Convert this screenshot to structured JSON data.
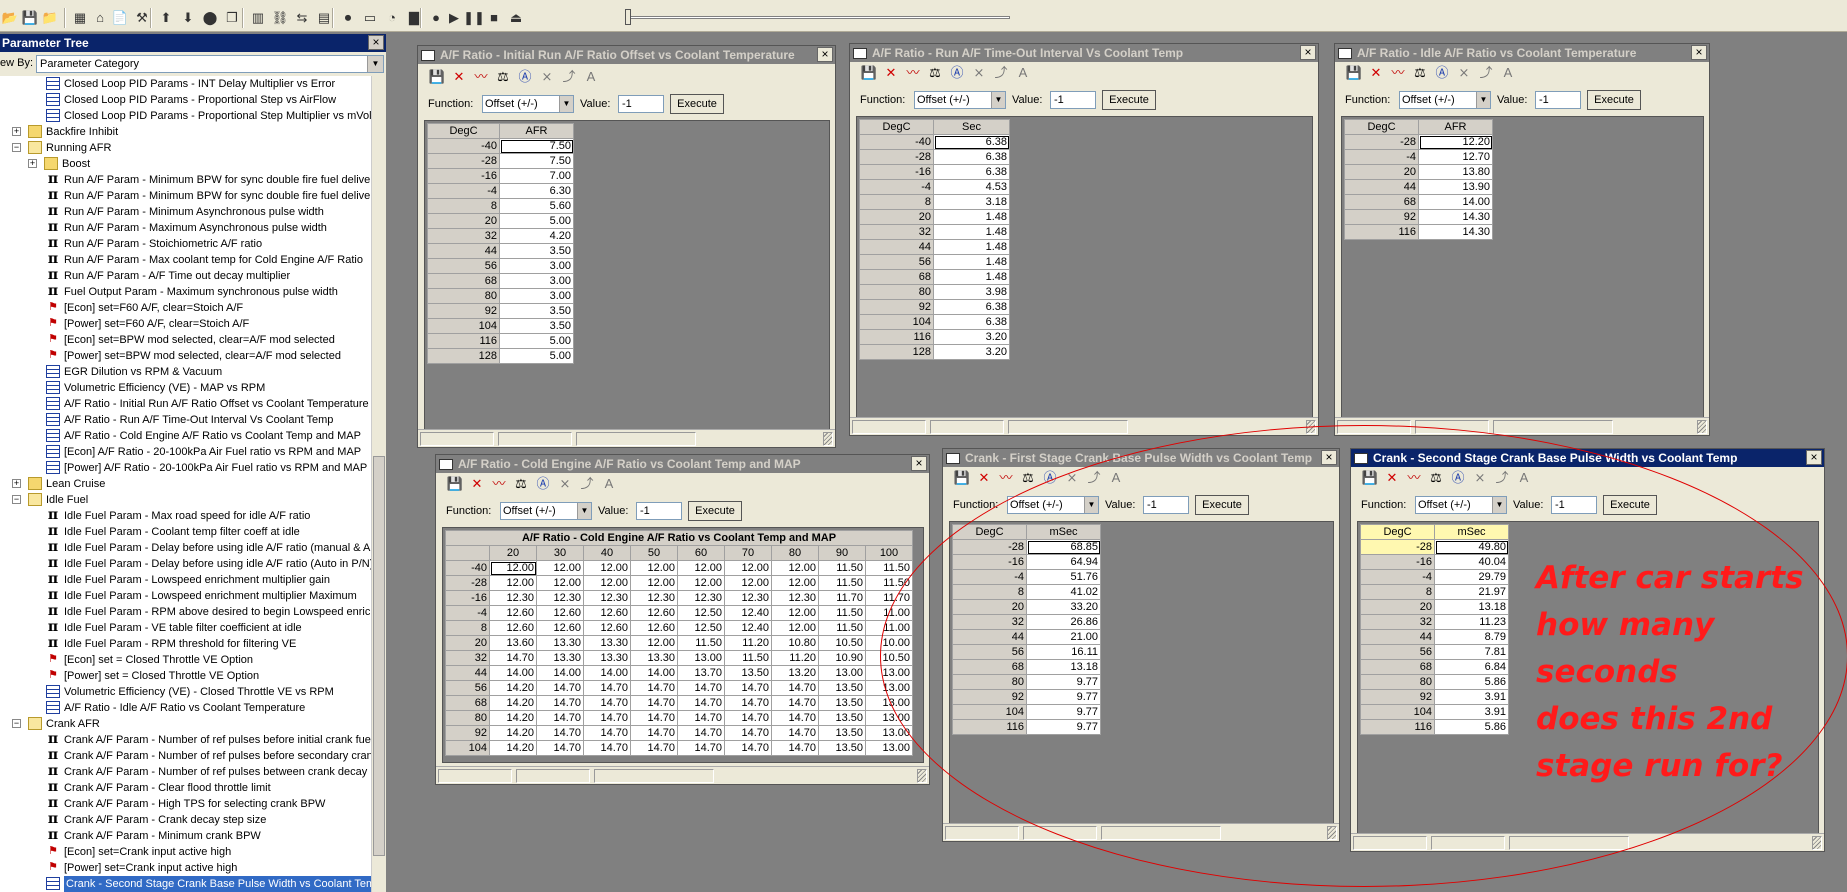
{
  "toolbar": {
    "icons": [
      "open-icon",
      "save-icon",
      "folder-icon",
      "chip-icon",
      "home-icon",
      "page-icon",
      "tools-icon",
      "up-arrow-icon",
      "down-arrow-icon",
      "record-icon",
      "copy-icon",
      "grid-icon",
      "link-icon",
      "swap-icon",
      "table-icon",
      "stop-icon",
      "note-icon",
      "globe-icon",
      "chart-icon",
      "disc-icon",
      "play-icon",
      "pause-icon",
      "stop-square-icon",
      "eject-icon"
    ],
    "glyphs": [
      "📂",
      "💾",
      "📁",
      "▦",
      "⌂",
      "📄",
      "⚒",
      "⬆",
      "⬇",
      "⬤",
      "❐",
      "▥",
      "⛓",
      "⇆",
      "▤",
      "⏺",
      "▭",
      "◔",
      "▇",
      "●",
      "▶",
      "❚❚",
      "■",
      "⏏"
    ],
    "slider_level": 0
  },
  "ptree": {
    "title": "Parameter Tree",
    "close": "×",
    "viewby_label": "ew By:",
    "viewby_value": "Parameter Category",
    "items": [
      {
        "indent": 2,
        "icon": "table",
        "text": "Closed Loop PID Params - INT Delay Multiplier vs Error"
      },
      {
        "indent": 2,
        "icon": "table",
        "text": "Closed Loop PID Params - Proportional Step vs AirFlow"
      },
      {
        "indent": 2,
        "icon": "table",
        "text": "Closed Loop PID Params - Proportional Step Multiplier vs mVolts"
      },
      {
        "indent": 1,
        "exp": "+",
        "icon": "folder",
        "text": "Backfire Inhibit"
      },
      {
        "indent": 1,
        "exp": "−",
        "icon": "folder-open",
        "text": "Running AFR"
      },
      {
        "indent": 2,
        "exp": "+",
        "icon": "folder",
        "text": "Boost"
      },
      {
        "indent": 2,
        "icon": "pi",
        "text": "Run A/F Param - Minimum BPW for sync double fire fuel delivery"
      },
      {
        "indent": 2,
        "icon": "pi",
        "text": "Run A/F Param - Minimum BPW for sync double fire fuel delivery"
      },
      {
        "indent": 2,
        "icon": "pi",
        "text": "Run A/F Param - Minimum Asynchronous pulse width"
      },
      {
        "indent": 2,
        "icon": "pi",
        "text": "Run A/F Param - Maximum Asynchronous pulse width"
      },
      {
        "indent": 2,
        "icon": "pi",
        "text": "Run A/F Param - Stoichiometric A/F ratio"
      },
      {
        "indent": 2,
        "icon": "pi",
        "text": "Run A/F Param - Max coolant temp for Cold Engine A/F Ratio"
      },
      {
        "indent": 2,
        "icon": "pi",
        "text": "Run A/F Param - A/F Time out decay multiplier"
      },
      {
        "indent": 2,
        "icon": "pi",
        "text": "Fuel Output Param - Maximum synchronous pulse width"
      },
      {
        "indent": 2,
        "icon": "flag",
        "text": "[Econ] set=F60 A/F, clear=Stoich A/F"
      },
      {
        "indent": 2,
        "icon": "flag",
        "text": "[Power] set=F60 A/F, clear=Stoich A/F"
      },
      {
        "indent": 2,
        "icon": "flag",
        "text": "[Econ] set=BPW mod selected, clear=A/F mod selected"
      },
      {
        "indent": 2,
        "icon": "flag",
        "text": "[Power] set=BPW mod selected, clear=A/F mod selected"
      },
      {
        "indent": 2,
        "icon": "table",
        "text": "EGR Dilution vs RPM & Vacuum"
      },
      {
        "indent": 2,
        "icon": "table",
        "text": "Volumetric Efficiency (VE) - MAP vs RPM"
      },
      {
        "indent": 2,
        "icon": "table",
        "text": "A/F Ratio - Initial Run A/F Ratio Offset vs Coolant Temperature"
      },
      {
        "indent": 2,
        "icon": "table",
        "text": "A/F Ratio - Run A/F Time-Out Interval Vs Coolant Temp"
      },
      {
        "indent": 2,
        "icon": "table",
        "text": "A/F Ratio - Cold Engine A/F Ratio vs Coolant Temp and MAP"
      },
      {
        "indent": 2,
        "icon": "table",
        "text": "[Econ] A/F Ratio - 20-100kPa Air Fuel ratio vs RPM and MAP"
      },
      {
        "indent": 2,
        "icon": "table",
        "text": "[Power] A/F Ratio - 20-100kPa Air Fuel ratio vs RPM and MAP"
      },
      {
        "indent": 1,
        "exp": "+",
        "icon": "folder",
        "text": "Lean Cruise"
      },
      {
        "indent": 1,
        "exp": "−",
        "icon": "folder-open",
        "text": "Idle Fuel"
      },
      {
        "indent": 2,
        "icon": "pi",
        "text": "Idle Fuel Param - Max road speed for idle A/F ratio"
      },
      {
        "indent": 2,
        "icon": "pi",
        "text": "Idle Fuel Param - Coolant temp filter coeff at idle"
      },
      {
        "indent": 2,
        "icon": "pi",
        "text": "Idle Fuel Param - Delay before using idle A/F ratio (manual & Au"
      },
      {
        "indent": 2,
        "icon": "pi",
        "text": "Idle Fuel Param - Delay before using idle A/F ratio (Auto in P/N)"
      },
      {
        "indent": 2,
        "icon": "pi",
        "text": "Idle Fuel Param - Lowspeed enrichment multiplier gain"
      },
      {
        "indent": 2,
        "icon": "pi",
        "text": "Idle Fuel Param - Lowspeed enrichment multiplier Maximum"
      },
      {
        "indent": 2,
        "icon": "pi",
        "text": "Idle Fuel Param - RPM above desired to begin Lowspeed enrichn"
      },
      {
        "indent": 2,
        "icon": "pi",
        "text": "Idle Fuel Param - VE table filter coefficient at idle"
      },
      {
        "indent": 2,
        "icon": "pi",
        "text": "Idle Fuel Param - RPM threshold for filtering VE"
      },
      {
        "indent": 2,
        "icon": "flag",
        "text": "[Econ] set = Closed Throttle VE Option"
      },
      {
        "indent": 2,
        "icon": "flag",
        "text": "[Power] set = Closed Throttle VE Option"
      },
      {
        "indent": 2,
        "icon": "table",
        "text": "Volumetric Efficiency (VE) - Closed Throttle VE vs RPM"
      },
      {
        "indent": 2,
        "icon": "table",
        "text": "A/F Ratio - Idle A/F Ratio vs Coolant Temperature"
      },
      {
        "indent": 1,
        "exp": "−",
        "icon": "folder-open",
        "text": "Crank AFR"
      },
      {
        "indent": 2,
        "icon": "pi",
        "text": "Crank A/F Param - Number of ref pulses before initial crank fuel"
      },
      {
        "indent": 2,
        "icon": "pi",
        "text": "Crank A/F Param - Number of ref pulses before secondary crank"
      },
      {
        "indent": 2,
        "icon": "pi",
        "text": "Crank A/F Param - Number of ref pulses between crank decay lo"
      },
      {
        "indent": 2,
        "icon": "pi",
        "text": "Crank A/F Param - Clear flood throttle limit"
      },
      {
        "indent": 2,
        "icon": "pi",
        "text": "Crank A/F Param - High TPS for selecting crank BPW"
      },
      {
        "indent": 2,
        "icon": "pi",
        "text": "Crank A/F Param - Crank decay step size"
      },
      {
        "indent": 2,
        "icon": "pi",
        "text": "Crank A/F Param - Minimum crank BPW"
      },
      {
        "indent": 2,
        "icon": "flag",
        "text": "[Econ] set=Crank input active high"
      },
      {
        "indent": 2,
        "icon": "flag",
        "text": "[Power] set=Crank input active high"
      },
      {
        "indent": 2,
        "icon": "table",
        "text": "Crank - Second Stage Crank Base Pulse Width vs Coolant Temp",
        "selected": true
      }
    ]
  },
  "win_common": {
    "function_label": "Function:",
    "function_value": "Offset (+/-)",
    "value_label": "Value:",
    "value_value": "-1",
    "execute": "Execute",
    "close": "×",
    "tool_glyphs": [
      "💾",
      "✕",
      "〰",
      "⚖",
      "Ⓐ",
      "⨯",
      "⤴",
      "A"
    ],
    "tool_names": [
      "save-icon",
      "delete-icon",
      "graph-icon",
      "scale-icon",
      "calibrate-icon",
      "clear-icon",
      "interpolate-icon",
      "text-icon"
    ]
  },
  "windows": {
    "w1": {
      "title": "A/F Ratio - Initial Run A/F Ratio Offset vs Coolant Temperature",
      "col1": "DegC",
      "col2": "AFR",
      "rows": [
        [
          "-40",
          "7.50"
        ],
        [
          "-28",
          "7.50"
        ],
        [
          "-16",
          "7.00"
        ],
        [
          "-4",
          "6.30"
        ],
        [
          "8",
          "5.60"
        ],
        [
          "20",
          "5.00"
        ],
        [
          "32",
          "4.20"
        ],
        [
          "44",
          "3.50"
        ],
        [
          "56",
          "3.00"
        ],
        [
          "68",
          "3.00"
        ],
        [
          "80",
          "3.00"
        ],
        [
          "92",
          "3.50"
        ],
        [
          "104",
          "3.50"
        ],
        [
          "116",
          "5.00"
        ],
        [
          "128",
          "5.00"
        ]
      ]
    },
    "w2": {
      "title": "A/F Ratio - Run A/F Time-Out Interval Vs Coolant Temp",
      "col1": "DegC",
      "col2": "Sec",
      "rows": [
        [
          "-40",
          "6.38"
        ],
        [
          "-28",
          "6.38"
        ],
        [
          "-16",
          "6.38"
        ],
        [
          "-4",
          "4.53"
        ],
        [
          "8",
          "3.18"
        ],
        [
          "20",
          "1.48"
        ],
        [
          "32",
          "1.48"
        ],
        [
          "44",
          "1.48"
        ],
        [
          "56",
          "1.48"
        ],
        [
          "68",
          "1.48"
        ],
        [
          "80",
          "3.98"
        ],
        [
          "92",
          "6.38"
        ],
        [
          "104",
          "6.38"
        ],
        [
          "116",
          "3.20"
        ],
        [
          "128",
          "3.20"
        ]
      ]
    },
    "w3": {
      "title": "A/F Ratio - Idle A/F Ratio vs Coolant Temperature",
      "col1": "DegC",
      "col2": "AFR",
      "rows": [
        [
          "-28",
          "12.20"
        ],
        [
          "-4",
          "12.70"
        ],
        [
          "20",
          "13.80"
        ],
        [
          "44",
          "13.90"
        ],
        [
          "68",
          "14.00"
        ],
        [
          "92",
          "14.30"
        ],
        [
          "116",
          "14.30"
        ]
      ]
    },
    "w4": {
      "title": "A/F Ratio - Cold Engine A/F Ratio vs Coolant Temp and MAP",
      "table_title": "A/F Ratio - Cold Engine A/F Ratio vs Coolant Temp and MAP",
      "cols": [
        "20",
        "30",
        "40",
        "50",
        "60",
        "70",
        "80",
        "90",
        "100"
      ],
      "rows": [
        [
          "-40",
          "12.00",
          "12.00",
          "12.00",
          "12.00",
          "12.00",
          "12.00",
          "12.00",
          "11.50",
          "11.50"
        ],
        [
          "-28",
          "12.00",
          "12.00",
          "12.00",
          "12.00",
          "12.00",
          "12.00",
          "12.00",
          "11.50",
          "11.50"
        ],
        [
          "-16",
          "12.30",
          "12.30",
          "12.30",
          "12.30",
          "12.30",
          "12.30",
          "12.30",
          "11.70",
          "11.70"
        ],
        [
          "-4",
          "12.60",
          "12.60",
          "12.60",
          "12.60",
          "12.50",
          "12.40",
          "12.00",
          "11.50",
          "11.00"
        ],
        [
          "8",
          "12.60",
          "12.60",
          "12.60",
          "12.60",
          "12.50",
          "12.40",
          "12.00",
          "11.50",
          "11.00"
        ],
        [
          "20",
          "13.60",
          "13.30",
          "13.30",
          "12.00",
          "11.50",
          "11.20",
          "10.80",
          "10.50",
          "10.00"
        ],
        [
          "32",
          "14.70",
          "13.30",
          "13.30",
          "13.30",
          "13.00",
          "11.50",
          "11.20",
          "10.90",
          "10.50"
        ],
        [
          "44",
          "14.00",
          "14.00",
          "14.00",
          "14.00",
          "13.70",
          "13.50",
          "13.20",
          "13.00",
          "13.00"
        ],
        [
          "56",
          "14.20",
          "14.70",
          "14.70",
          "14.70",
          "14.70",
          "14.70",
          "14.70",
          "13.50",
          "13.00"
        ],
        [
          "68",
          "14.20",
          "14.70",
          "14.70",
          "14.70",
          "14.70",
          "14.70",
          "14.70",
          "13.50",
          "13.00"
        ],
        [
          "80",
          "14.20",
          "14.70",
          "14.70",
          "14.70",
          "14.70",
          "14.70",
          "14.70",
          "13.50",
          "13.00"
        ],
        [
          "92",
          "14.20",
          "14.70",
          "14.70",
          "14.70",
          "14.70",
          "14.70",
          "14.70",
          "13.50",
          "13.00"
        ],
        [
          "104",
          "14.20",
          "14.70",
          "14.70",
          "14.70",
          "14.70",
          "14.70",
          "14.70",
          "13.50",
          "13.00"
        ]
      ]
    },
    "w5": {
      "title": "Crank - First Stage Crank Base Pulse Width vs Coolant Temp",
      "col1": "DegC",
      "col2": "mSec",
      "rows": [
        [
          "-28",
          "68.85"
        ],
        [
          "-16",
          "64.94"
        ],
        [
          "-4",
          "51.76"
        ],
        [
          "8",
          "41.02"
        ],
        [
          "20",
          "33.20"
        ],
        [
          "32",
          "26.86"
        ],
        [
          "44",
          "21.00"
        ],
        [
          "56",
          "16.11"
        ],
        [
          "68",
          "13.18"
        ],
        [
          "80",
          "9.77"
        ],
        [
          "92",
          "9.77"
        ],
        [
          "104",
          "9.77"
        ],
        [
          "116",
          "9.77"
        ]
      ]
    },
    "w6": {
      "title": "Crank - Second Stage Crank Base Pulse Width vs Coolant Temp",
      "col1": "DegC",
      "col2": "mSec",
      "rows": [
        [
          "-28",
          "49.80"
        ],
        [
          "-16",
          "40.04"
        ],
        [
          "-4",
          "29.79"
        ],
        [
          "8",
          "21.97"
        ],
        [
          "20",
          "13.18"
        ],
        [
          "32",
          "11.23"
        ],
        [
          "44",
          "8.79"
        ],
        [
          "56",
          "7.81"
        ],
        [
          "68",
          "6.84"
        ],
        [
          "80",
          "5.86"
        ],
        [
          "92",
          "3.91"
        ],
        [
          "104",
          "3.91"
        ],
        [
          "116",
          "5.86"
        ]
      ]
    }
  },
  "annotation": {
    "lines": [
      "After car starts",
      "how many seconds",
      "does this 2nd",
      "stage run for?"
    ],
    "color": "#ff1a1a"
  }
}
